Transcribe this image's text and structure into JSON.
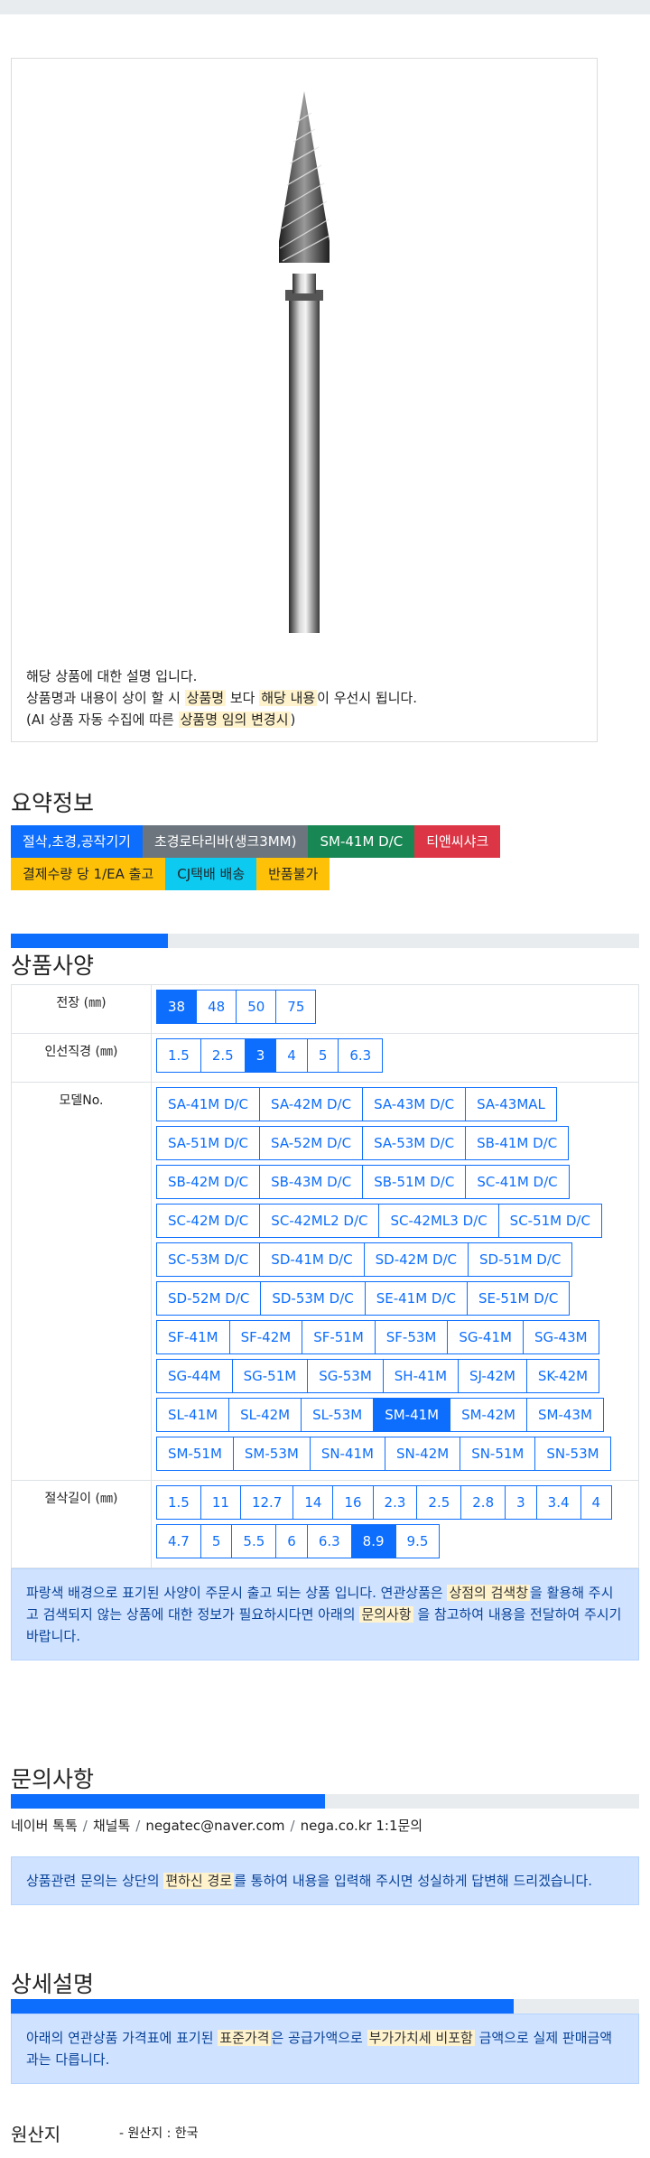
{
  "product": {
    "desc_line1": "해당 상품에 대한 설명 입니다.",
    "desc_line2_a": "상품명과 내용이 상이 할 시 ",
    "desc_line2_mark1": "상품명",
    "desc_line2_b": " 보다 ",
    "desc_line2_mark2": "해당 내용",
    "desc_line2_c": "이 우선시 됩니다.",
    "desc_line3_a": "(AI 상품 자동 수집에 따른 ",
    "desc_line3_mark": "상품명 임의 변경시",
    "desc_line3_b": ")"
  },
  "summary": {
    "title": "요약정보",
    "tags": [
      {
        "label": "절삭,초경,공작기기",
        "color": "blue"
      },
      {
        "label": "초경로타리바(생크3MM)",
        "color": "gray"
      },
      {
        "label": "SM-41M D/C",
        "color": "green"
      },
      {
        "label": "티앤씨샤크",
        "color": "red"
      },
      {
        "label": "결제수량 당 1/EA 출고",
        "color": "yellow"
      },
      {
        "label": "CJ택배 배송",
        "color": "cyan"
      },
      {
        "label": "반품불가",
        "color": "yellow"
      }
    ]
  },
  "specs": {
    "title": "상품사양",
    "progress": 0.25,
    "rows": [
      {
        "label": "전장 (㎜)",
        "options": [
          "38",
          "48",
          "50",
          "75"
        ],
        "active": "38"
      },
      {
        "label": "인선직경 (㎜)",
        "options": [
          "1.5",
          "2.5",
          "3",
          "4",
          "5",
          "6.3"
        ],
        "active": "3"
      },
      {
        "label": "모델No.",
        "options": [
          "SA-41M D/C",
          "SA-42M D/C",
          "SA-43M D/C",
          "SA-43MAL",
          "SA-51M D/C",
          "SA-52M D/C",
          "SA-53M D/C",
          "SB-41M D/C",
          "SB-42M D/C",
          "SB-43M D/C",
          "SB-51M D/C",
          "SC-41M D/C",
          "SC-42M D/C",
          "SC-42ML2 D/C",
          "SC-42ML3 D/C",
          "SC-51M D/C",
          "SC-53M D/C",
          "SD-41M D/C",
          "SD-42M D/C",
          "SD-51M D/C",
          "SD-52M D/C",
          "SD-53M D/C",
          "SE-41M D/C",
          "SE-51M D/C",
          "SF-41M",
          "SF-42M",
          "SF-51M",
          "SF-53M",
          "SG-41M",
          "SG-43M",
          "SG-44M",
          "SG-51M",
          "SG-53M",
          "SH-41M",
          "SJ-42M",
          "SK-42M",
          "SL-41M",
          "SL-42M",
          "SL-53M",
          "SM-41M",
          "SM-42M",
          "SM-43M",
          "SM-51M",
          "SM-53M",
          "SN-41M",
          "SN-42M",
          "SN-51M",
          "SN-53M"
        ],
        "active": "SM-41M"
      },
      {
        "label": "절삭길이 (㎜)",
        "options": [
          "1.5",
          "11",
          "12.7",
          "14",
          "16",
          "2.3",
          "2.5",
          "2.8",
          "3",
          "3.4",
          "4",
          "4.7",
          "5",
          "5.5",
          "6",
          "6.3",
          "8.9",
          "9.5"
        ],
        "active": "8.9"
      }
    ],
    "notice_a": "파랑색 배경으로 표기된 사양이 주문시 출고 되는 상품 입니다. 연관상품은 ",
    "notice_mark1": "상점의 검색창",
    "notice_b": "을 활용해 주시고 검색되지 않는 상품에 대한 정보가 필요하시다면 아래의 ",
    "notice_mark2": "문의사항",
    "notice_c": " 을 참고하여 내용을 전달하여 주시기 바랍니다."
  },
  "inquiry": {
    "title": "문의사항",
    "progress": 0.5,
    "links": [
      "네이버 톡톡",
      "채널톡",
      "negatec@naver.com",
      "nega.co.kr 1:1문의"
    ],
    "notice_a": "상품관련 문의는 상단의 ",
    "notice_mark": "편하신 경로",
    "notice_b": "를 통하여 내용을 입력해 주시면 성실하게 답변해 드리겠습니다."
  },
  "detail": {
    "title": "상세설명",
    "progress": 0.8,
    "notice_a": "아래의 연관상품 가격표에 표기된 ",
    "notice_mark1": "표준가격",
    "notice_b": "은 공급가액으로 ",
    "notice_mark2": "부가가치세 비포함",
    "notice_c": " 금액으로 실제 판매금액과는 다릅니다."
  },
  "origin": {
    "label": "원산지",
    "value": "- 원산지 : 한국"
  }
}
